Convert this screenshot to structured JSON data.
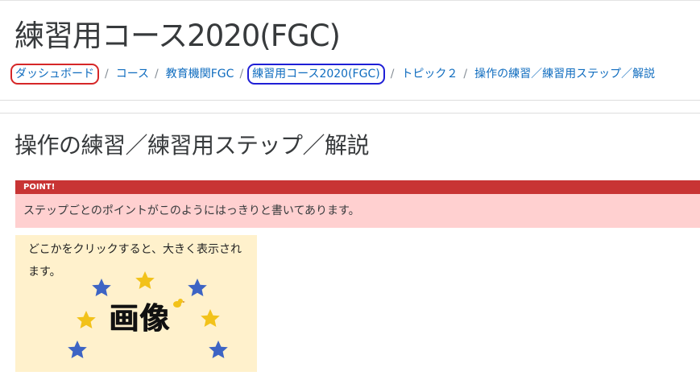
{
  "course": {
    "title": "練習用コース2020(FGC)"
  },
  "breadcrumb": {
    "items": [
      {
        "label": "ダッシュボード"
      },
      {
        "label": "コース"
      },
      {
        "label": "教育機関FGC"
      },
      {
        "label": "練習用コース2020(FGC)"
      },
      {
        "label": "トピック２"
      },
      {
        "label": "操作の練習／練習用ステップ／解説"
      }
    ],
    "separator": "/"
  },
  "page": {
    "heading": "操作の練習／練習用ステップ／解説"
  },
  "point": {
    "label": "POINT!",
    "text": "ステップごとのポイントがこのようにはっきりと書いてあります。"
  },
  "image_card": {
    "caption": "どこかをクリックすると、大きく表示されます。",
    "image_word": "画像"
  },
  "colors": {
    "link": "#0f6cbf",
    "highlight_red": "#d62728",
    "highlight_blue": "#1f1fd6",
    "point_header": "#c83434",
    "point_background": "#ffd0d0",
    "card_background": "#fff1cc",
    "star_gold": "#f2c21a",
    "star_blue": "#3d64c4"
  }
}
